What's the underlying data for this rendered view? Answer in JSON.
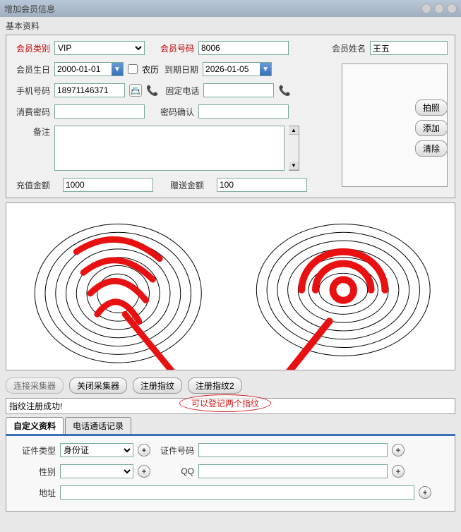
{
  "window": {
    "title": "增加会员信息"
  },
  "basic": {
    "section_label": "基本资料",
    "member_type_label": "会员类别",
    "member_type_value": "VIP",
    "member_no_label": "会员号码",
    "member_no_value": "8006",
    "member_name_label": "会员姓名",
    "member_name_value": "王五",
    "birthday_label": "会员生日",
    "birthday_value": "2000-01-01",
    "lunar_label": "农历",
    "expiry_label": "到期日期",
    "expiry_value": "2026-01-05",
    "mobile_label": "手机号码",
    "mobile_value": "18971146371",
    "landline_label": "固定电话",
    "landline_value": "",
    "password_label": "消费密码",
    "password_value": "",
    "password_confirm_label": "密码确认",
    "password_confirm_value": "",
    "remarks_label": "备注",
    "remarks_value": "",
    "recharge_label": "充值金额",
    "recharge_value": "1000",
    "bonus_label": "赠送金额",
    "bonus_value": "100"
  },
  "side_buttons": {
    "photo": "拍照",
    "add": "添加",
    "clear": "清除"
  },
  "fp_buttons": {
    "connect": "连接采集器",
    "close": "关闭采集器",
    "reg1": "注册指纹",
    "reg2": "注册指纹2"
  },
  "status_text": "指纹注册成功!",
  "annotation": "可以登记两个指纹",
  "tabs": {
    "t1": "自定义资料",
    "t2": "电话通话记录"
  },
  "bottom": {
    "id_type_label": "证件类型",
    "id_type_value": "身份证",
    "id_no_label": "证件号码",
    "id_no_value": "",
    "gender_label": "性别",
    "gender_value": "",
    "qq_label": "QQ",
    "qq_value": "",
    "address_label": "地址",
    "address_value": ""
  }
}
